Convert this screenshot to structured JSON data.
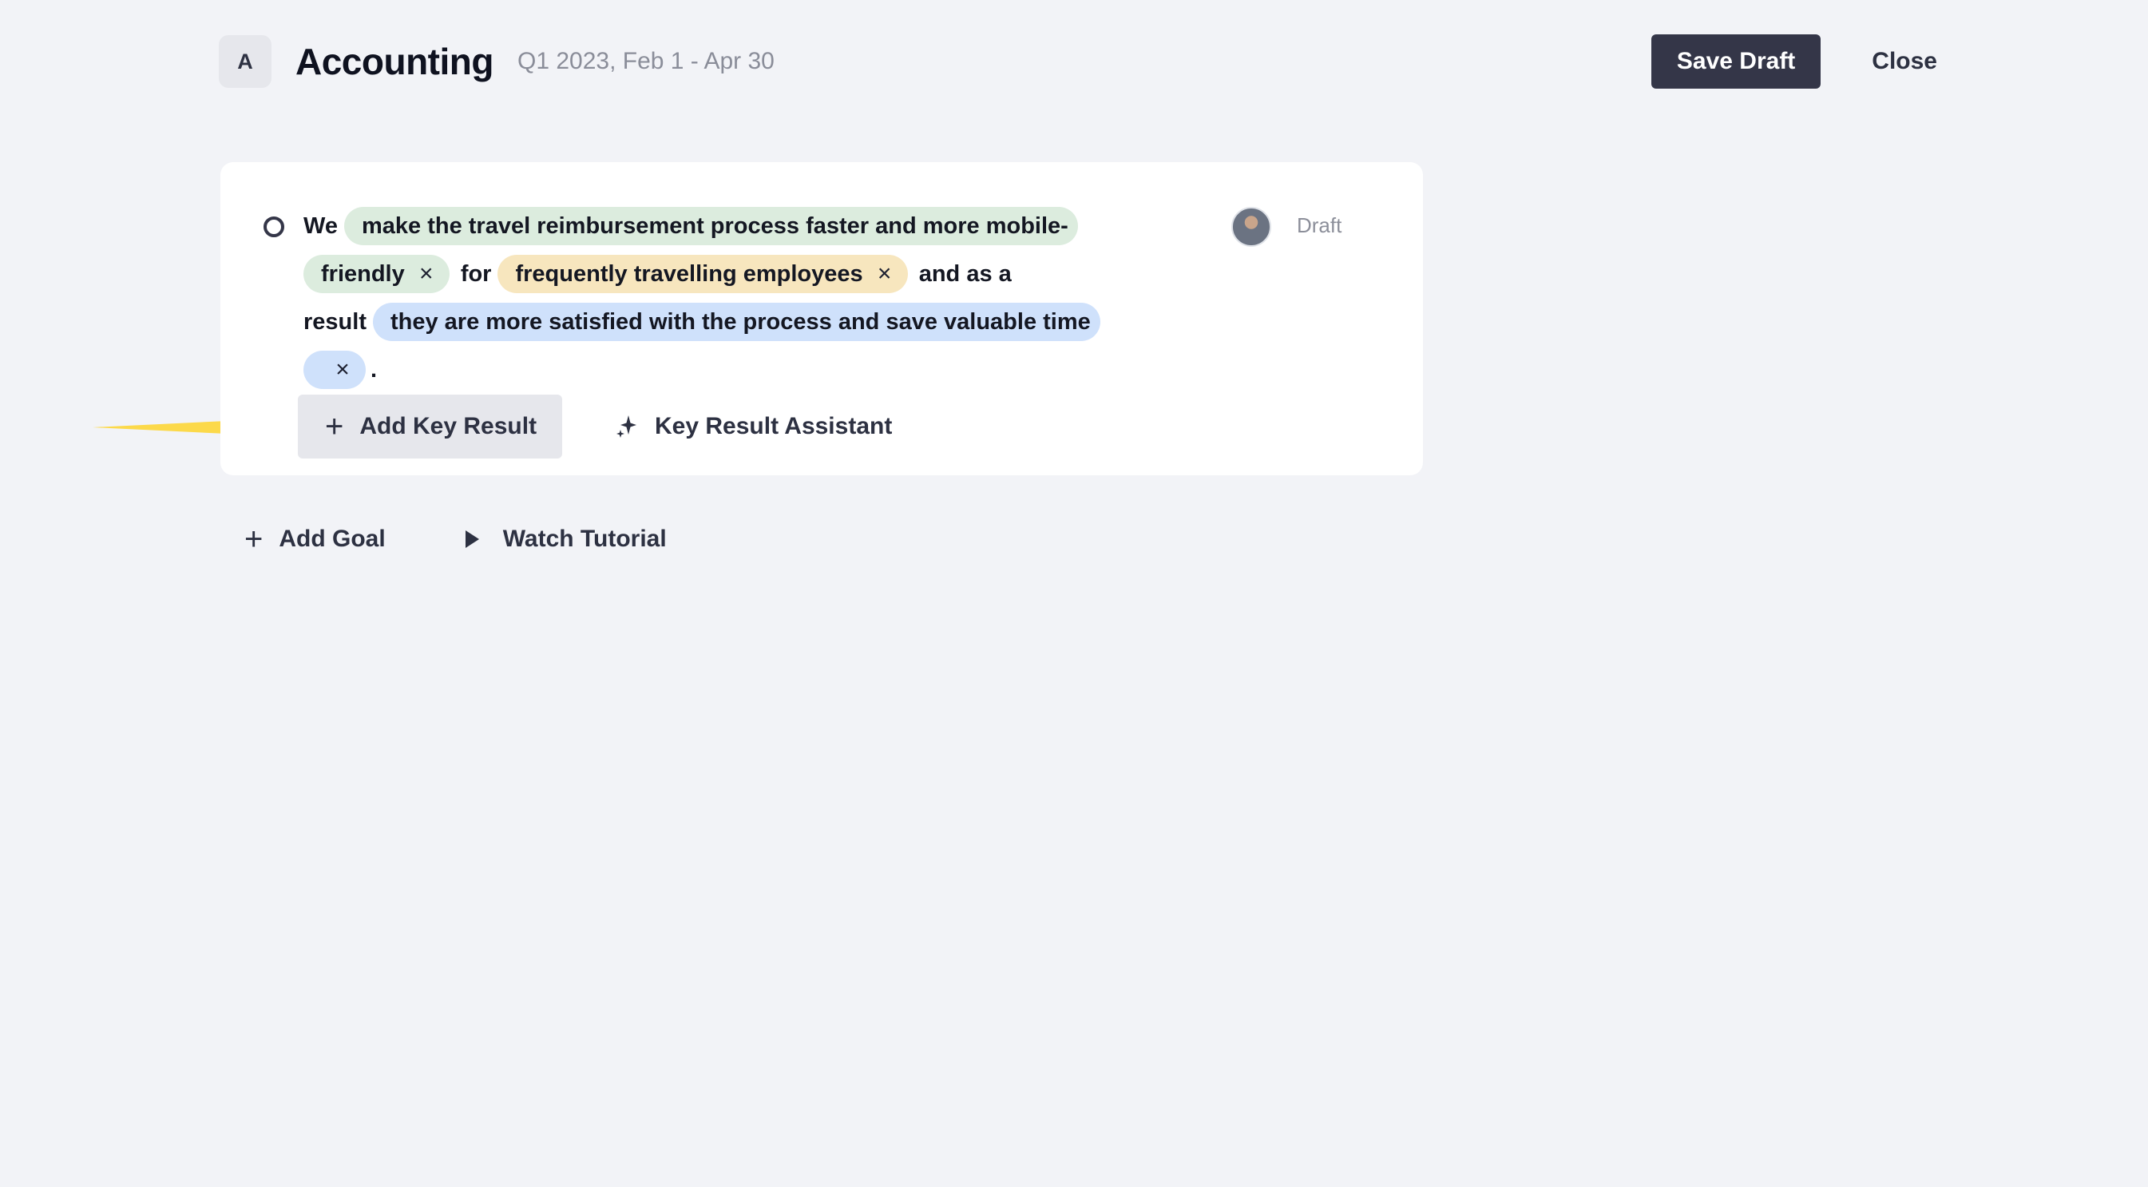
{
  "header": {
    "avatar_letter": "A",
    "title": "Accounting",
    "period": "Q1 2023, Feb 1 - Apr 30",
    "save_label": "Save Draft",
    "close_label": "Close"
  },
  "goal": {
    "prefix": "We",
    "action": "make the travel reimbursement process faster and more mobile-friendly",
    "for_word": "for",
    "audience": "frequently travelling employees",
    "result_connector": "and as a result",
    "outcome": "they are more satisfied with the process and save valuable time",
    "end_punct": ".",
    "status": "Draft",
    "chip_colors": {
      "action": "#dcecde",
      "audience": "#f7e6be",
      "outcome": "#cfe1fb"
    },
    "actions": {
      "add_key_result": "Add Key Result",
      "key_result_assistant": "Key Result Assistant"
    }
  },
  "footer_actions": {
    "add_goal": "Add Goal",
    "watch_tutorial": "Watch Tutorial"
  },
  "icons": {
    "remove": "×",
    "plus": "+"
  },
  "colors": {
    "primary_button": "#343648",
    "annotation_arrow": "#fcd94a",
    "background": "#f2f3f7"
  }
}
